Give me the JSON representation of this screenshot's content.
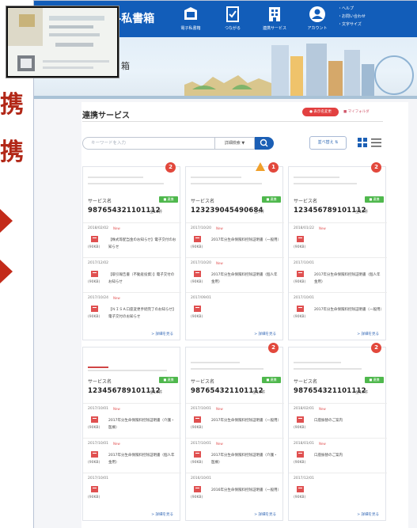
{
  "side": {
    "chars": [
      "携",
      "携"
    ]
  },
  "nav": {
    "logo_text": "e-私書箱",
    "items": [
      {
        "label": "電子私書箱",
        "icon": "mailbox-icon"
      },
      {
        "label": "つながる",
        "icon": "link-document-icon"
      },
      {
        "label": "連携サービス",
        "icon": "building-icon"
      },
      {
        "label": "アカウント",
        "icon": "account-icon"
      }
    ],
    "links": [
      "・ヘルプ",
      "・お問い合わせ",
      "・文字サイズ"
    ]
  },
  "banner": {
    "title_suffix": "箱"
  },
  "section": {
    "title": "連携サービス",
    "primary_pill": "● 表示名変更",
    "secondary_link": "■ マイフォルダ"
  },
  "search": {
    "placeholder": "キーワードを入力",
    "detail_label": "詳細検索 ▼",
    "sort_label": "並べ替え ⇅"
  },
  "cards": [
    {
      "badge": "2",
      "warning": false,
      "service_label": "サービス名",
      "flag": "■ 連携",
      "number": "987654321101112",
      "count": "全10件",
      "rows": [
        {
          "date": "2018/02/02",
          "new": "New",
          "size": "(90KB)",
          "text": "【株式等配当金のお知らせ】電子交付のお知らせ"
        },
        {
          "date": "2017/12/02",
          "new": "",
          "size": "(90KB)",
          "text": "【取引報告書（不動産投資）】電子交付のお知らせ"
        },
        {
          "date": "2017/10/24",
          "new": "New",
          "size": "(90KB)",
          "text": "【ＮＩＳＡ口座変更手続完了のお知らせ】電子交付のお知らせ"
        }
      ],
      "detail": "> 詳細を見る"
    },
    {
      "badge": "1",
      "warning": true,
      "service_label": "サービス名",
      "flag": "■ 連携",
      "number": "123239045490684",
      "count": "全5件",
      "rows": [
        {
          "date": "2017/10/20",
          "new": "New",
          "size": "(90KB)",
          "text": "2017年分生命保険料控除証明書（一般用）"
        },
        {
          "date": "2017/10/20",
          "new": "New",
          "size": "(90KB)",
          "text": "2017年分生命保険料控除証明書（個人年金用）"
        },
        {
          "date": "2017/09/01",
          "new": "",
          "size": "(90KB)",
          "text": ""
        }
      ],
      "detail": "> 詳細を見る"
    },
    {
      "badge": "2",
      "warning": false,
      "service_label": "サービス名",
      "flag": "■ 連携",
      "number": "123456789101112",
      "count": "全10件",
      "rows": [
        {
          "date": "2018/01/22",
          "new": "New",
          "size": "(90KB)",
          "text": ""
        },
        {
          "date": "2017/10/01",
          "new": "",
          "size": "(90KB)",
          "text": "2017年分生命保険料控除証明書（個人年金用）"
        },
        {
          "date": "2017/10/01",
          "new": "",
          "size": "(90KB)",
          "text": "2017年分生命保険料控除証明書（一般用）"
        }
      ],
      "detail": "> 詳細を見る"
    },
    {
      "badge": "",
      "warning": false,
      "service_label": "サービス名",
      "flag": "■ 連携",
      "number": "123456789101112",
      "count": "全10件",
      "rows": [
        {
          "date": "2017/10/01",
          "new": "New",
          "size": "(90KB)",
          "text": "2017年分生命保険料控除証明書（介護・医療）"
        },
        {
          "date": "2017/10/01",
          "new": "New",
          "size": "(90KB)",
          "text": "2017年分生命保険料控除証明書（個人年金用）"
        },
        {
          "date": "2017/10/01",
          "new": "",
          "size": "(90KB)",
          "text": ""
        }
      ],
      "detail": "> 詳細を見る"
    },
    {
      "badge": "2",
      "warning": false,
      "service_label": "サービス名",
      "flag": "■ 連携",
      "number": "987654321101112",
      "count": "全10件",
      "rows": [
        {
          "date": "2017/10/01",
          "new": "New",
          "size": "(90KB)",
          "text": "2017年分生命保険料控除証明書（一般用）"
        },
        {
          "date": "2017/10/01",
          "new": "New",
          "size": "(90KB)",
          "text": "2017年分生命保険料控除証明書（介護・医療）"
        },
        {
          "date": "2016/10/01",
          "new": "",
          "size": "(90KB)",
          "text": "2016年分生命保険料控除証明書（一般用）"
        }
      ],
      "detail": "> 詳細を見る"
    },
    {
      "badge": "2",
      "warning": false,
      "service_label": "サービス名",
      "flag": "■ 連携",
      "number": "987654321101112",
      "count": "全10件",
      "rows": [
        {
          "date": "2018/02/01",
          "new": "New",
          "size": "(90KB)",
          "text": "口座振替のご案内"
        },
        {
          "date": "2018/01/01",
          "new": "New",
          "size": "(90KB)",
          "text": "口座振替のご案内"
        },
        {
          "date": "2017/12/01",
          "new": "",
          "size": "(90KB)",
          "text": ""
        }
      ],
      "detail": "> 詳細を見る"
    }
  ],
  "colors": {
    "nav": "#125db9",
    "accent": "#1b5fb5",
    "badge": "#e2483c",
    "flag": "#4fb84d",
    "side": "#b22818"
  }
}
